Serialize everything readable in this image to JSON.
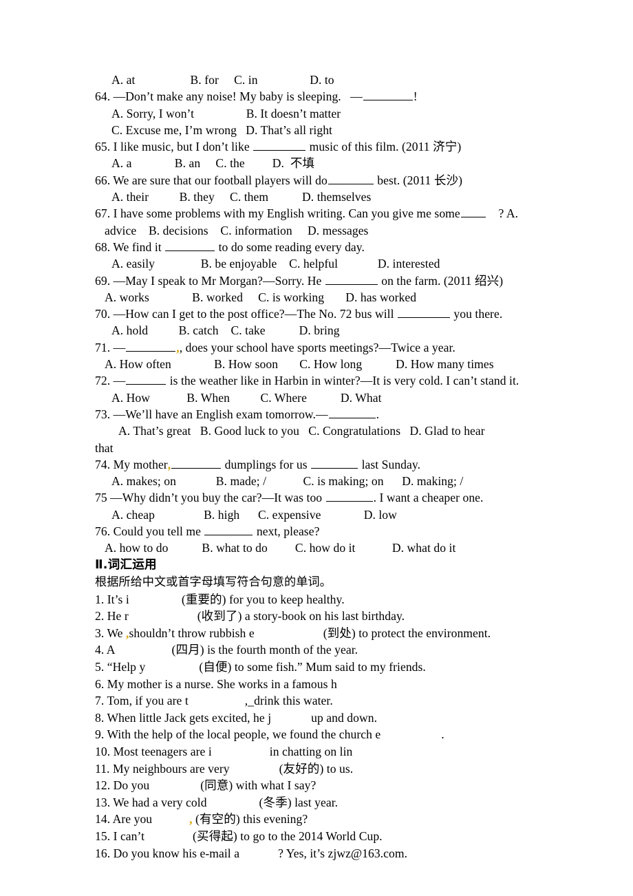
{
  "document": {
    "type": "english-exam-worksheet",
    "language_mix": [
      "English",
      "Chinese"
    ]
  },
  "grammar_section": {
    "continued_options_line": "A. at                  B. for     C. in                 D. to",
    "questions": [
      {
        "number": "64.",
        "stem_pre": "—Don’t make any noise! My baby is sleeping.   —",
        "stem_post": "!",
        "blank_width": 72,
        "options_lines": [
          "A. Sorry, I won’t                 B. It doesn’t matter",
          "C. Excuse me, I’m wrong   D. That’s all right"
        ]
      },
      {
        "number": "65.",
        "stem_pre": "I like music, but I don’t like ",
        "stem_post": " music of this film. (2011 济宁)",
        "blank_width": 76,
        "options_lines": [
          "A. a              B. an     C. the         D.  不填"
        ]
      },
      {
        "number": "66.",
        "stem_pre": "We are sure that our football players will do",
        "stem_post": " best. (2011 长沙)",
        "blank_width": 66,
        "options_lines": [
          "A. their          B. they     C. them           D. themselves"
        ]
      },
      {
        "number": "67.",
        "stem_pre": "I have some problems with my English writing. Can you give me some",
        "stem_post": "    ? A.",
        "blank_width": 36,
        "options_lines": [
          "advice    B. decisions    C. information     D. messages"
        ]
      },
      {
        "number": "68.",
        "stem_pre": "We find it ",
        "stem_post": " to do some reading every day.",
        "blank_width": 72,
        "options_lines": [
          "A. easily               B. be enjoyable    C. helpful             D. interested"
        ]
      },
      {
        "number": "69.",
        "stem_pre": "—May I speak to Mr Morgan?—Sorry. He ",
        "stem_post": " on the farm. (2011 绍兴)",
        "blank_width": 76,
        "options_lines": [
          "A. works              B. worked     C. is working       D. has worked"
        ]
      },
      {
        "number": "70.",
        "stem_pre": "—How can I get to the post office?—The No. 72 bus will ",
        "stem_post": " you there.",
        "blank_width": 76,
        "options_lines": [
          "A. hold          B. catch    C. take           D. bring"
        ]
      },
      {
        "number": "71.",
        "stem_pre": "—",
        "stem_post": ", does your school have sports meetings?—Twice a year.",
        "blank_width": 72,
        "mark_after_blank": true,
        "options_lines": [
          "A. How often              B. How soon       C. How long           D. How many times"
        ]
      },
      {
        "number": "72.",
        "stem_pre": "—",
        "stem_post": " is the weather like in Harbin in winter?—It is very cold. I can’t stand it.",
        "blank_width": 58,
        "options_lines": [
          "A. How            B. When          C. Where           D. What"
        ]
      },
      {
        "number": "73.",
        "stem_pre": "—We’ll have an English exam tomorrow.—",
        "stem_post": ".",
        "blank_width": 68,
        "options_lines": [
          "A. That’s great   B. Good luck to you   C. Congratulations   D. Glad to hear",
          "that"
        ]
      },
      {
        "number": "74.",
        "stem_pre": "My mother",
        "stem_post": " dumplings for us ",
        "stem_tail": " last Sunday.",
        "blank_width": 72,
        "blank2_width": 68,
        "mark_after_stem_pre": true,
        "options_lines": [
          "A. makes; on             B. made; /            C. is making; on      D. making; /"
        ]
      },
      {
        "number": "75",
        "stem_pre": "—Why didn’t you buy the car?—It was too ",
        "stem_post": ". I want a cheaper one.",
        "blank_width": 68,
        "options_lines": [
          "A. cheap                B. high      C. expensive              D. low"
        ]
      },
      {
        "number": "76.",
        "stem_pre": "Could you tell me ",
        "stem_post": " next, please?",
        "blank_width": 70,
        "options_lines": [
          "A. how to do           B. what to do         C. how do it            D. what do it"
        ]
      }
    ]
  },
  "vocab_section": {
    "heading": "Ⅱ.词汇运用",
    "instruction": "根据所给中文或首字母填写符合句意的单词。",
    "items": [
      {
        "number": "1.",
        "pre": "It’s i",
        "gap": 76,
        "post": "(重要的) for you to keep healthy."
      },
      {
        "number": "2.",
        "pre": "He r",
        "gap": 100,
        "post": "(收到了) a story-book on his last birthday."
      },
      {
        "number": "3.",
        "pre": "We ",
        "mark": true,
        "pre2": "shouldn’t throw rubbish e",
        "gap": 100,
        "post": "(到处) to protect the environment."
      },
      {
        "number": "4.",
        "pre": "A",
        "gap": 82,
        "post": "(四月) is the fourth month of the year."
      },
      {
        "number": "5.",
        "pre": "“Help y",
        "gap": 78,
        "post": "(自便) to some fish.” Mum said to my friends."
      },
      {
        "number": "6.",
        "pre": "My mother is a nurse. She works in a famous h",
        "gap": 0,
        "post": ""
      },
      {
        "number": "7.",
        "pre": "Tom, if you are t",
        "gap": 82,
        "post": ",_drink this water."
      },
      {
        "number": "8.",
        "pre": "When little Jack gets excited, he j",
        "gap": 58,
        "post": "up and down."
      },
      {
        "number": "9.",
        "pre": "With the help of the local people, we found the church e",
        "gap": 88,
        "post": "."
      },
      {
        "number": "10.",
        "pre": "Most teenagers are i",
        "gap": 84,
        "post": "in chatting on lin"
      },
      {
        "number": "11.",
        "pre": "My neighbours are very",
        "gap": 72,
        "post": "(友好的) to us."
      },
      {
        "number": "12.",
        "pre": "Do you",
        "gap": 74,
        "post": "(同意) with what I say?"
      },
      {
        "number": "13.",
        "pre": "We had a very cold",
        "gap": 76,
        "post": "(冬季) last year."
      },
      {
        "number": "14.",
        "pre": "Are you",
        "gap": 54,
        "mark_mid": true,
        "post": " (有空的) this evening?"
      },
      {
        "number": "15.",
        "pre": "I can’t",
        "gap": 70,
        "post": "(买得起) to go to the 2014 World Cup."
      },
      {
        "number": "16.",
        "pre": "Do you know his e-mail a",
        "gap": 56,
        "post": "? Yes, it’s zjwz@163.com."
      }
    ]
  },
  "colors": {
    "text": "#000000",
    "background": "#ffffff",
    "annotation_mark": "#d9a300"
  }
}
